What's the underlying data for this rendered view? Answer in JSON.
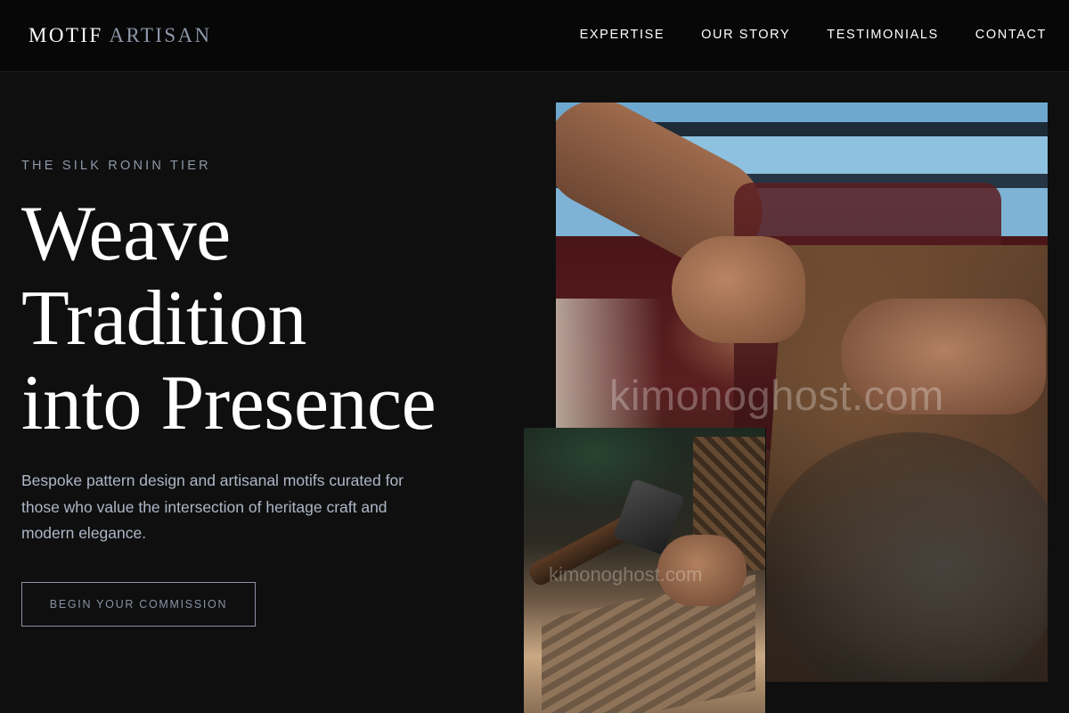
{
  "header": {
    "logo_primary": "MOTIF",
    "logo_accent": "ARTISAN",
    "nav": [
      {
        "label": "EXPERTISE"
      },
      {
        "label": "OUR STORY"
      },
      {
        "label": "TESTIMONIALS"
      },
      {
        "label": "CONTACT"
      }
    ]
  },
  "hero": {
    "eyebrow": "THE SILK RONIN TIER",
    "headline_lines": [
      "Weave",
      "Tradition",
      "into Presence"
    ],
    "description": "Bespoke pattern design and artisanal motifs curated for those who value the intersection of heritage craft and modern elegance.",
    "cta_label": "BEGIN YOUR COMMISSION"
  },
  "images": {
    "main_watermark": "kimonoghost.com",
    "small_watermark": "kimonoghost.com"
  },
  "colors": {
    "background": "#0f0f10",
    "header_background": "#070707",
    "accent_text": "#8d97a8",
    "body_text": "#aeb7c6"
  }
}
